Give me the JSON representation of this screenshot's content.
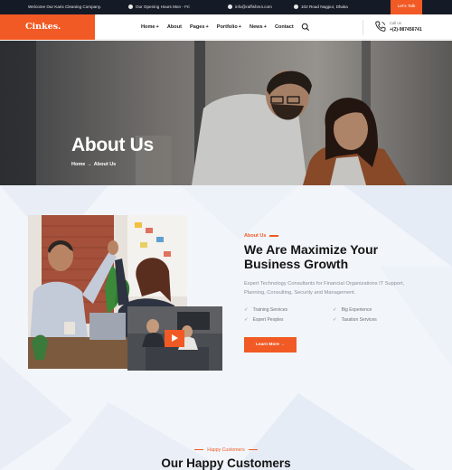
{
  "topbar": {
    "welcome": "Welcome Our Karix Cleaning Company.",
    "hours": "Our Opening Hours Mon - Fri",
    "email": "info@raffishm4.com",
    "address": "102 Road Nagpur, Dhaka",
    "cta": "Let's Talk"
  },
  "header": {
    "logo": "Cinkes.",
    "nav": [
      {
        "label": "Home",
        "plus": "+"
      },
      {
        "label": "About",
        "plus": ""
      },
      {
        "label": "Pages",
        "plus": "+"
      },
      {
        "label": "Portfolio",
        "plus": "+"
      },
      {
        "label": "News",
        "plus": "+"
      },
      {
        "label": "Contact",
        "plus": ""
      }
    ],
    "call_label": "Call us",
    "call_number": "+(2)-987456741"
  },
  "hero": {
    "title": "About Us",
    "breadcrumb_home": "Home",
    "breadcrumb_sep": "→",
    "breadcrumb_current": "About Us"
  },
  "about": {
    "eyebrow": "About Us",
    "heading": "We Are Maximize Your Business Growth",
    "description": "Expert Technology Consultants for Financial Organizations IT Support, Planning, Consulting, Security and Management.",
    "features": [
      "Training Services",
      "Big Experience",
      "Expert Peoples",
      "Taxation Services"
    ],
    "button": "Learn More"
  },
  "testimonials": {
    "eyebrow": "Happy Customers",
    "title": "Our Happy Customers"
  },
  "colors": {
    "accent": "#f15a24",
    "dark": "#151b26"
  }
}
